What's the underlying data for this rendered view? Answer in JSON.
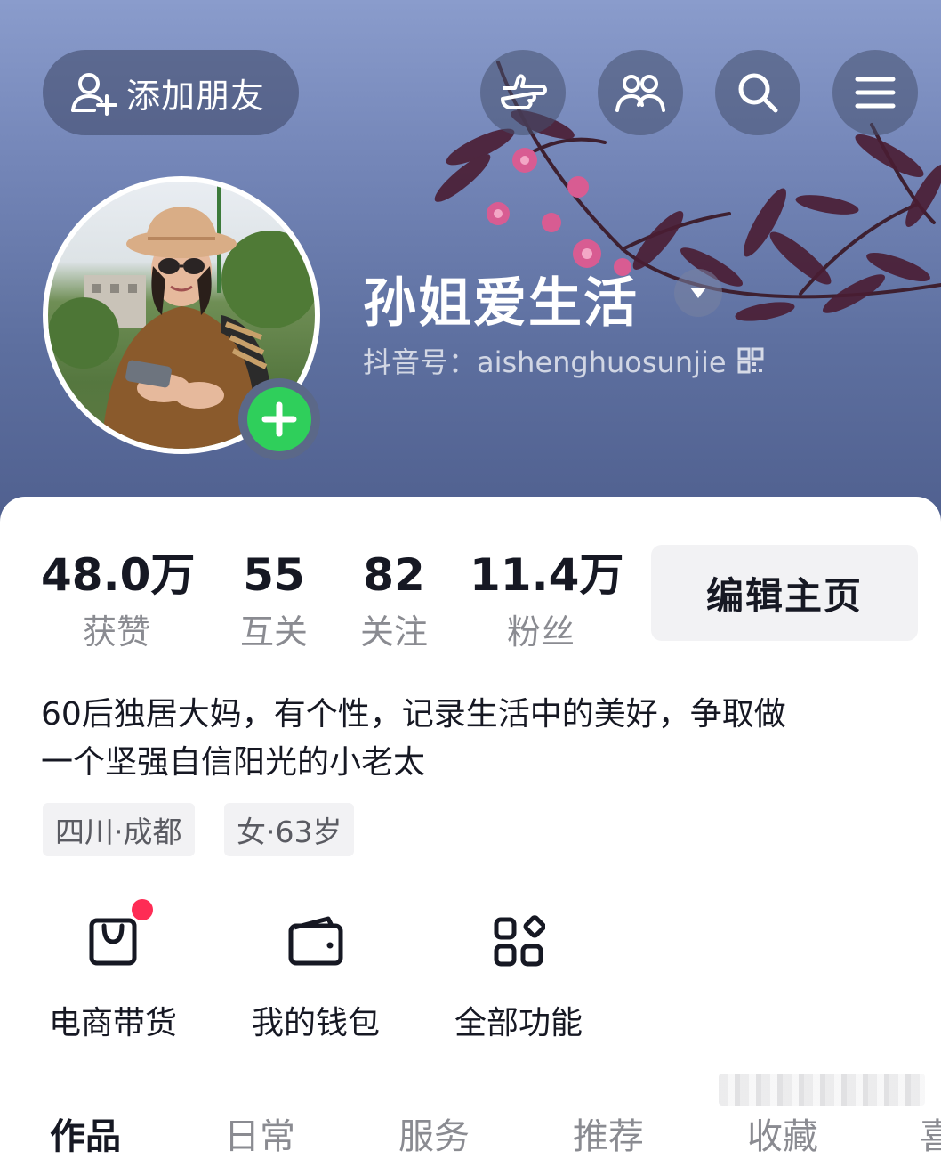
{
  "header": {
    "add_friend_label": "添加朋友",
    "icons": [
      "hand-point-icon",
      "friends-icon",
      "search-icon",
      "menu-icon"
    ]
  },
  "profile": {
    "nickname": "孙姐爱生活",
    "douyin_id": "抖音号：aishenghuosunjie"
  },
  "stats": [
    {
      "value": "48.0万",
      "label": "获赞"
    },
    {
      "value": "55",
      "label": "互关"
    },
    {
      "value": "82",
      "label": "关注"
    },
    {
      "value": "11.4万",
      "label": "粉丝"
    }
  ],
  "edit_button_label": "编辑主页",
  "bio": {
    "line1": "60后独居大妈，有个性，记录生活中的美好，争取做",
    "line2": "一个坚强自信阳光的小老太"
  },
  "tags": [
    "四川·成都",
    "女·63岁"
  ],
  "functions": [
    {
      "label": "电商带货",
      "icon": "shopping-bag-icon",
      "has_dot": true
    },
    {
      "label": "我的钱包",
      "icon": "wallet-icon",
      "has_dot": false
    },
    {
      "label": "全部功能",
      "icon": "apps-grid-icon",
      "has_dot": false
    }
  ],
  "tabs": [
    "作品",
    "日常",
    "服务",
    "推荐",
    "收藏",
    "喜"
  ],
  "colors": {
    "accent_red": "#fe2c55",
    "plus_green": "#2fcf5b",
    "text_primary": "#161823",
    "text_secondary": "#8a8b91"
  }
}
